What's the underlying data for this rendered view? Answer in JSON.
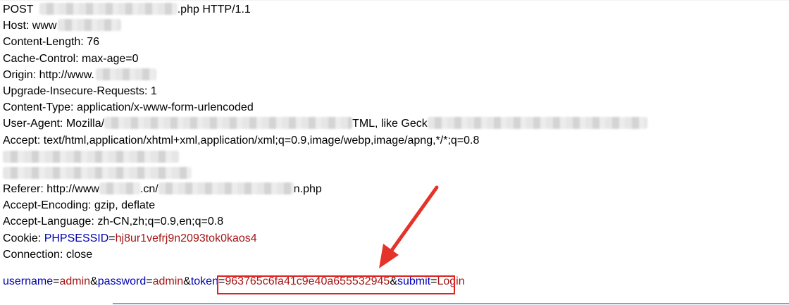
{
  "request": {
    "request_line": {
      "method": "POST",
      "after_blur": ".php HTTP/1.1"
    },
    "host": {
      "label": "Host: www"
    },
    "content_length": "Content-Length: 76",
    "cache_control": "Cache-Control: max-age=0",
    "origin": {
      "label": "Origin: http://www."
    },
    "upgrade": "Upgrade-Insecure-Requests: 1",
    "content_type": "Content-Type: application/x-www-form-urlencoded",
    "user_agent": {
      "label": "User-Agent: Mozilla/",
      "middle": "TML, like Geck"
    },
    "accept": "Accept: text/html,application/xhtml+xml,application/xml;q=0.9,image/webp,image/apng,*/*;q=0.8",
    "referer": {
      "label": "Referer: http://www",
      "middle": ".cn/",
      "end": "n.php"
    },
    "accept_encoding": "Accept-Encoding: gzip, deflate",
    "accept_language": "Accept-Language: zh-CN,zh;q=0.9,en;q=0.8",
    "cookie": {
      "label": "Cookie: ",
      "name": "PHPSESSID",
      "eq": "=",
      "value": "hj8ur1vefrj9n2093tok0kaos4"
    },
    "connection": "Connection: close"
  },
  "body_params": [
    {
      "key": "username",
      "value": "admin"
    },
    {
      "key": "password",
      "value": "admin"
    },
    {
      "key": "token",
      "value": "963765c6fa41c9e40a655532945"
    },
    {
      "key": "submit",
      "value": "Login"
    }
  ],
  "separators": {
    "eq": "=",
    "amp": "&"
  },
  "colors": {
    "param_key": "#0000b3",
    "param_value": "#a31515",
    "highlight": "#e0221f",
    "arrow": "#e5332a"
  }
}
